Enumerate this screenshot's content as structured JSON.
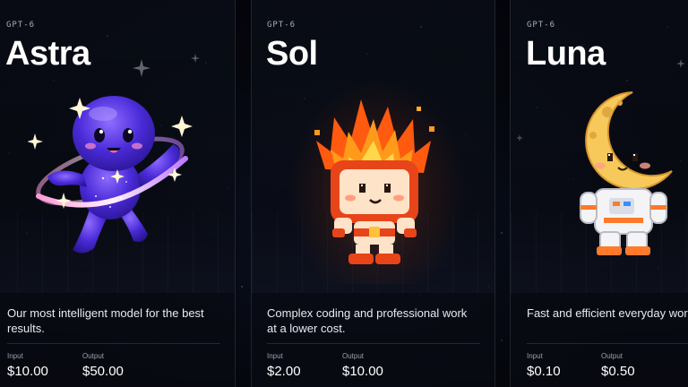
{
  "cards": [
    {
      "eyebrow": "GPT-6",
      "name": "Astra",
      "description": "Our most intelligent model for the best results.",
      "input_label": "Input",
      "input_price": "$10.00",
      "output_label": "Output",
      "output_price": "$50.00",
      "mascot_icon": "galaxy-mascot-icon"
    },
    {
      "eyebrow": "GPT-6",
      "name": "Sol",
      "description": "Complex coding and professional work at a lower cost.",
      "input_label": "Input",
      "input_price": "$2.00",
      "output_label": "Output",
      "output_price": "$10.00",
      "mascot_icon": "sun-mascot-icon"
    },
    {
      "eyebrow": "GPT-6",
      "name": "Luna",
      "description": "Fast and efficient everyday work at scale.",
      "input_label": "Input",
      "input_price": "$0.10",
      "output_label": "Output",
      "output_price": "$0.50",
      "mascot_icon": "moon-astronaut-mascot-icon"
    }
  ],
  "colors": {
    "background": "#03050b",
    "card_border": "#2a2e38",
    "astra_purple": "#6a3df0",
    "sol_orange": "#ff6a1a",
    "luna_yellow": "#f7c95a"
  }
}
